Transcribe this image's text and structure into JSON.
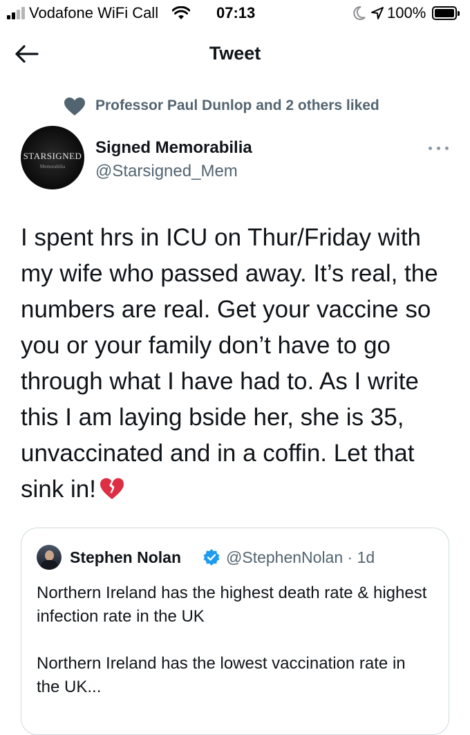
{
  "status_bar": {
    "carrier": "Vodafone WiFi Call",
    "time": "07:13",
    "battery": "100%"
  },
  "header": {
    "title": "Tweet"
  },
  "social_context": {
    "text": "Professor Paul Dunlop and 2 others liked"
  },
  "author": {
    "name": "Signed Memorabilia",
    "handle": "@Starsigned_Mem",
    "avatar_logo": "STARSIGNED",
    "avatar_logo_sub": "Memorabilia"
  },
  "tweet": {
    "text": "I spent hrs in ICU on Thur/Friday with my wife who passed away. It’s real, the numbers are real. Get your vaccine so you or your family don’t have to go through what I have had to. As I write this I am laying bside her, she is 35, unvaccinated and in a coffin. Let that sink in!",
    "emoji": "broken-heart-icon"
  },
  "quoted_tweet": {
    "name": "Stephen Nolan",
    "handle": "@StephenNolan",
    "separator": "·",
    "age": "1d",
    "paragraph_1": "Northern Ireland has the highest death rate & highest infection rate in the UK",
    "paragraph_2": "Northern Ireland has the lowest vaccination rate in the UK..."
  },
  "colors": {
    "text_primary": "#0f1419",
    "text_secondary": "#536471",
    "verified_blue": "#1d9bf0",
    "broken_heart_red": "#dd2e44",
    "border": "#cfd9de"
  }
}
